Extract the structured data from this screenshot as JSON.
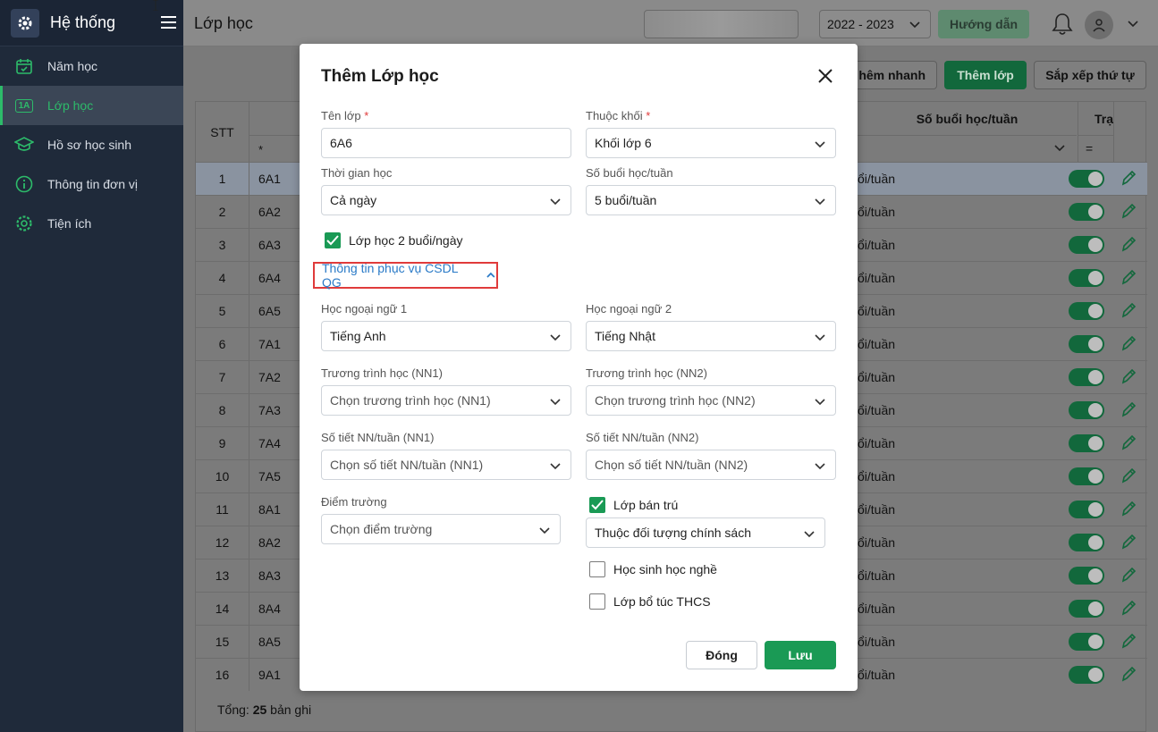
{
  "sidebar": {
    "brand": "Hệ thống",
    "items": [
      {
        "label": "Năm học",
        "icon": "calendar-icon"
      },
      {
        "label": "Lớp học",
        "icon": "class-badge-icon",
        "badge": "1A",
        "active": true
      },
      {
        "label": "Hồ sơ học sinh",
        "icon": "graduation-cap-icon"
      },
      {
        "label": "Thông tin đơn vị",
        "icon": "info-icon"
      },
      {
        "label": "Tiện ích",
        "icon": "gear-icon"
      }
    ]
  },
  "header": {
    "title": "Lớp học",
    "year": "2022 - 2023",
    "guide_label": "Hướng dẫn"
  },
  "toolbar": {
    "quick_add_label": "hêm nhanh",
    "add_label": "Thêm lớp",
    "sort_label": "Sắp xếp thứ tự"
  },
  "table": {
    "col_stt": "STT",
    "col_buoi": "Số buổi học/tuần",
    "col_status": "Trạ",
    "filter_star": "*",
    "filter_eq": "=",
    "rows": [
      {
        "stt": "1",
        "name": "6A1",
        "buoi": "ổi/tuần"
      },
      {
        "stt": "2",
        "name": "6A2",
        "buoi": "ổi/tuần"
      },
      {
        "stt": "3",
        "name": "6A3",
        "buoi": "ổi/tuần"
      },
      {
        "stt": "4",
        "name": "6A4",
        "buoi": "ổi/tuần"
      },
      {
        "stt": "5",
        "name": "6A5",
        "buoi": "ổi/tuần"
      },
      {
        "stt": "6",
        "name": "7A1",
        "buoi": "ổi/tuần"
      },
      {
        "stt": "7",
        "name": "7A2",
        "buoi": "ổi/tuần"
      },
      {
        "stt": "8",
        "name": "7A3",
        "buoi": "ổi/tuần"
      },
      {
        "stt": "9",
        "name": "7A4",
        "buoi": "ổi/tuần"
      },
      {
        "stt": "10",
        "name": "7A5",
        "buoi": "ổi/tuần"
      },
      {
        "stt": "11",
        "name": "8A1",
        "buoi": "ổi/tuần"
      },
      {
        "stt": "12",
        "name": "8A2",
        "buoi": "ổi/tuần"
      },
      {
        "stt": "13",
        "name": "8A3",
        "buoi": "ổi/tuần"
      },
      {
        "stt": "14",
        "name": "8A4",
        "buoi": "ổi/tuần"
      },
      {
        "stt": "15",
        "name": "8A5",
        "buoi": "ổi/tuần"
      },
      {
        "stt": "16",
        "name": "9A1",
        "buoi": "ổi/tuần"
      }
    ],
    "footer_prefix": "Tổng:",
    "footer_count": "25",
    "footer_suffix": "bản ghi"
  },
  "modal": {
    "title": "Thêm Lớp học",
    "ten_lop_label": "Tên lớp",
    "ten_lop_value": "6A6",
    "required_mark": "*",
    "thuoc_khoi_label": "Thuộc khối",
    "thuoc_khoi_value": "Khối lớp 6",
    "thoi_gian_label": "Thời gian học",
    "thoi_gian_value": "Cả ngày",
    "so_buoi_label": "Số buổi học/tuần",
    "so_buoi_value": "5 buổi/tuần",
    "two_sessions_label": "Lớp học 2 buổi/ngày",
    "section_label": "Thông tin phục vụ CSDL QG",
    "nn1_label": "Học ngoại ngữ 1",
    "nn1_value": "Tiếng Anh",
    "nn2_label": "Học ngoại ngữ 2",
    "nn2_value": "Tiếng Nhật",
    "ct_nn1_label": "Trương trình học (NN1)",
    "ct_nn1_placeholder": "Chọn trương trình học (NN1)",
    "ct_nn2_label": "Trương trình học (NN2)",
    "ct_nn2_placeholder": "Chọn trương trình học (NN2)",
    "st_nn1_label": "Số tiết NN/tuần (NN1)",
    "st_nn1_placeholder": "Chọn số tiết NN/tuần (NN1)",
    "st_nn2_label": "Số tiết NN/tuần (NN2)",
    "st_nn2_placeholder": "Chọn số tiết NN/tuần (NN2)",
    "diem_truong_label": "Điểm trường",
    "diem_truong_placeholder": "Chọn điểm trường",
    "ban_tru_label": "Lớp bán trú",
    "doi_tuong_placeholder": "Thuộc đối tượng chính sách",
    "hoc_nghe_label": "Học sinh học nghề",
    "bo_tuc_label": "Lớp bổ túc THCS",
    "close_label": "Đóng",
    "save_label": "Lưu"
  },
  "colors": {
    "accent": "#1a9a55",
    "link": "#2a7ac7",
    "highlight_border": "#e03b3b",
    "sidebar_bg": "#1f2a3a"
  }
}
